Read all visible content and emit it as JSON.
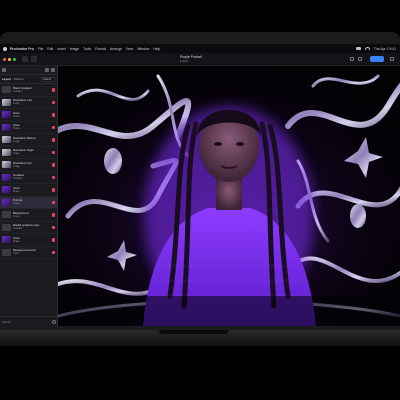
{
  "menubar": {
    "app_name": "Pixelmator Pro",
    "items": [
      "File",
      "Edit",
      "Insert",
      "Image",
      "Tools",
      "Format",
      "Arrange",
      "View",
      "Window",
      "Help"
    ],
    "clock": "Tue Apr 1  9:41"
  },
  "toolbar": {
    "doc_title": "Purple Portrait",
    "doc_subtitle": "Edited"
  },
  "layers_panel": {
    "tabs": [
      "Layers",
      "Photos"
    ],
    "search_placeholder": "Search",
    "layers": [
      {
        "name": "Black Gradient",
        "sub": "Gradient",
        "thumb": "dark",
        "selected": false
      },
      {
        "name": "Illustration Left",
        "sub": "Image",
        "thumb": "chrome",
        "selected": false
      },
      {
        "name": "Glow",
        "sub": "Shape",
        "thumb": "purple",
        "selected": false
      },
      {
        "name": "Glow",
        "sub": "Shape",
        "thumb": "purple",
        "selected": false
      },
      {
        "name": "Illustration Bottom",
        "sub": "Image",
        "thumb": "chrome",
        "selected": false
      },
      {
        "name": "Illustration Right",
        "sub": "Image",
        "thumb": "chrome",
        "selected": false
      },
      {
        "name": "Illustration Top",
        "sub": "Image",
        "thumb": "chrome",
        "selected": false
      },
      {
        "name": "Gradient",
        "sub": "Gradient",
        "thumb": "purple",
        "selected": false
      },
      {
        "name": "Glow",
        "sub": "Shape",
        "thumb": "purple",
        "selected": false
      },
      {
        "name": "Portrait",
        "sub": "Image",
        "thumb": "purple",
        "selected": true
      },
      {
        "name": "Background",
        "sub": "Image",
        "thumb": "dark",
        "selected": false
      },
      {
        "name": "Radial gradient copy",
        "sub": "Gradient",
        "thumb": "dark",
        "selected": false
      },
      {
        "name": "Glow",
        "sub": "Shape",
        "thumb": "purple",
        "selected": false
      },
      {
        "name": "Background Color",
        "sub": "Color",
        "thumb": "dark",
        "selected": false
      }
    ],
    "footer_label": "Search"
  },
  "colors": {
    "accent": "#3b82f6",
    "portrait_purple": "#7b2ff0",
    "glow": "#b469ff",
    "visibility_toggle": "#e8455e"
  },
  "icons": [
    "apple-icon",
    "wifi-icon",
    "battery-icon",
    "search-icon",
    "share-icon",
    "eye-icon"
  ]
}
